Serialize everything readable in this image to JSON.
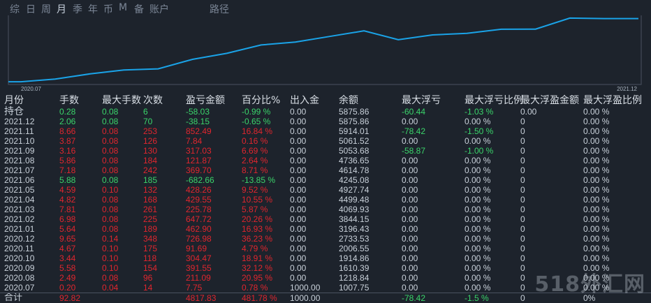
{
  "tabs": [
    {
      "label": "综",
      "active": false
    },
    {
      "label": "日",
      "active": false
    },
    {
      "label": "周",
      "active": false
    },
    {
      "label": "月",
      "active": true
    },
    {
      "label": "季",
      "active": false
    },
    {
      "label": "年",
      "active": false
    },
    {
      "label": "币",
      "active": false
    },
    {
      "label": "M",
      "active": false
    },
    {
      "label": "备",
      "active": false
    },
    {
      "label": "账户",
      "active": false
    },
    {
      "label": "路径",
      "active": false
    }
  ],
  "chart_data": {
    "type": "line",
    "x": [
      "2020.07",
      "2020.08",
      "2020.09",
      "2020.10",
      "2020.11",
      "2020.12",
      "2021.01",
      "2021.02",
      "2021.03",
      "2021.04",
      "2021.05",
      "2021.06",
      "2021.07",
      "2021.08",
      "2021.09",
      "2021.10",
      "2021.11",
      "2021.12",
      "持仓"
    ],
    "values": [
      1007.75,
      1218.84,
      1610.39,
      1914.86,
      2006.55,
      2733.53,
      3196.43,
      3844.15,
      4069.93,
      4499.48,
      4927.74,
      4245.08,
      4614.78,
      4736.65,
      5053.68,
      5061.52,
      5914.01,
      5875.86,
      5875.86
    ],
    "xtick_first": "2020.07",
    "xtick_last": "2021.12",
    "line_color": "#1aa3e8",
    "grid": false
  },
  "table": {
    "headers": [
      "月份",
      "手数",
      "最大手数",
      "次数",
      "盈亏金额",
      "百分比%",
      "出入金",
      "余额",
      "最大浮亏",
      "最大浮亏比例",
      "最大浮盈金额",
      "最大浮盈比例"
    ],
    "rows": [
      {
        "c": [
          "持仓",
          "0.28",
          "0.08",
          "6",
          "-58.03",
          "-0.99 %",
          "0.00",
          "5875.86",
          "-60.44",
          "-1.03 %",
          "0.00",
          "0.00 %"
        ],
        "color": "#3ad46a"
      },
      {
        "c": [
          "2021.12",
          "2.06",
          "0.08",
          "70",
          "-38.15",
          "-0.65 %",
          "0.00",
          "5875.86",
          "0.00",
          "0.00 %",
          "0",
          "0.00 %"
        ],
        "color": "#3ad46a"
      },
      {
        "c": [
          "2021.11",
          "8.66",
          "0.08",
          "253",
          "852.49",
          "16.84 %",
          "0.00",
          "5914.01",
          "-78.42",
          "-1.50 %",
          "0",
          "0.00 %"
        ],
        "color": "#e0262e"
      },
      {
        "c": [
          "2021.10",
          "3.87",
          "0.08",
          "126",
          "7.84",
          "0.16 %",
          "0.00",
          "5061.52",
          "0.00",
          "0.00 %",
          "0",
          "0.00 %"
        ],
        "color": "#e0262e"
      },
      {
        "c": [
          "2021.09",
          "3.16",
          "0.08",
          "130",
          "317.03",
          "6.69 %",
          "0.00",
          "5053.68",
          "-58.87",
          "-1.00 %",
          "0",
          "0.00 %"
        ],
        "color": "#e0262e"
      },
      {
        "c": [
          "2021.08",
          "5.86",
          "0.08",
          "184",
          "121.87",
          "2.64 %",
          "0.00",
          "4736.65",
          "0.00",
          "0.00 %",
          "0",
          "0.00 %"
        ],
        "color": "#e0262e"
      },
      {
        "c": [
          "2021.07",
          "7.18",
          "0.08",
          "242",
          "369.70",
          "8.71 %",
          "0.00",
          "4614.78",
          "0.00",
          "0.00 %",
          "0",
          "0.00 %"
        ],
        "color": "#e0262e"
      },
      {
        "c": [
          "2021.06",
          "5.88",
          "0.08",
          "185",
          "-682.66",
          "-13.85 %",
          "0.00",
          "4245.08",
          "0.00",
          "0.00 %",
          "0",
          "0.00 %"
        ],
        "color": "#3ad46a"
      },
      {
        "c": [
          "2021.05",
          "4.59",
          "0.10",
          "132",
          "428.26",
          "9.52 %",
          "0.00",
          "4927.74",
          "0.00",
          "0.00 %",
          "0",
          "0.00 %"
        ],
        "color": "#e0262e"
      },
      {
        "c": [
          "2021.04",
          "4.82",
          "0.08",
          "168",
          "429.55",
          "10.55 %",
          "0.00",
          "4499.48",
          "0.00",
          "0.00 %",
          "0",
          "0.00 %"
        ],
        "color": "#e0262e"
      },
      {
        "c": [
          "2021.03",
          "7.81",
          "0.08",
          "261",
          "225.78",
          "5.87 %",
          "0.00",
          "4069.93",
          "0.00",
          "0.00 %",
          "0",
          "0.00 %"
        ],
        "color": "#e0262e"
      },
      {
        "c": [
          "2021.02",
          "6.98",
          "0.08",
          "225",
          "647.72",
          "20.26 %",
          "0.00",
          "3844.15",
          "0.00",
          "0.00 %",
          "0",
          "0.00 %"
        ],
        "color": "#e0262e"
      },
      {
        "c": [
          "2021.01",
          "5.64",
          "0.08",
          "189",
          "462.90",
          "16.93 %",
          "0.00",
          "3196.43",
          "0.00",
          "0.00 %",
          "0",
          "0.00 %"
        ],
        "color": "#e0262e"
      },
      {
        "c": [
          "2020.12",
          "9.65",
          "0.14",
          "348",
          "726.98",
          "36.23 %",
          "0.00",
          "2733.53",
          "0.00",
          "0.00 %",
          "0",
          "0.00 %"
        ],
        "color": "#e0262e"
      },
      {
        "c": [
          "2020.11",
          "4.67",
          "0.10",
          "175",
          "91.69",
          "4.79 %",
          "0.00",
          "2006.55",
          "0.00",
          "0.00 %",
          "0",
          "0.00 %"
        ],
        "color": "#e0262e"
      },
      {
        "c": [
          "2020.10",
          "3.44",
          "0.10",
          "118",
          "304.47",
          "18.91 %",
          "0.00",
          "1914.86",
          "0.00",
          "0.00 %",
          "0",
          "0.00 %"
        ],
        "color": "#e0262e"
      },
      {
        "c": [
          "2020.09",
          "5.58",
          "0.10",
          "154",
          "391.55",
          "32.12 %",
          "0.00",
          "1610.39",
          "0.00",
          "0.00 %",
          "0",
          "0.00 %"
        ],
        "color": "#e0262e"
      },
      {
        "c": [
          "2020.08",
          "2.49",
          "0.08",
          "96",
          "211.09",
          "20.95 %",
          "0.00",
          "1218.84",
          "0.00",
          "0.00 %",
          "0",
          "0.00 %"
        ],
        "color": "#e0262e"
      },
      {
        "c": [
          "2020.07",
          "0.20",
          "0.04",
          "14",
          "7.75",
          "0.78 %",
          "1000.00",
          "1007.75",
          "0.00",
          "0.00 %",
          "0",
          "0.00 %"
        ],
        "color": "#e0262e"
      }
    ],
    "total": {
      "c": [
        "合计",
        "92.82",
        "",
        "",
        "4817.83",
        "481.78 %",
        "1000.00",
        "",
        "-78.42",
        "-1.5 %",
        "0",
        "0%"
      ],
      "color": "#e0262e"
    },
    "neutral_color": "#c9d1da",
    "green": "#3ad46a",
    "red": "#e0262e"
  },
  "watermark": "518外汇网"
}
